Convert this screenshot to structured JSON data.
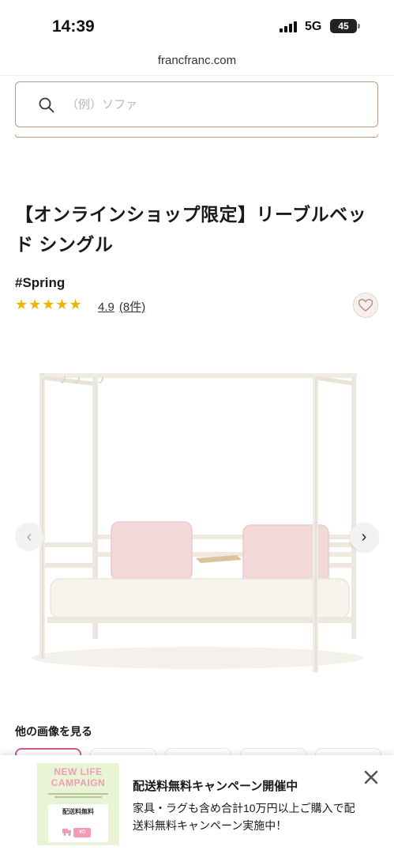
{
  "status_bar": {
    "time": "14:39",
    "network": "5G",
    "battery": "45"
  },
  "browser": {
    "url": "francfranc.com"
  },
  "search": {
    "placeholder": "（例）ソファ",
    "value": "",
    "icon": "search-icon"
  },
  "product": {
    "title": "【オンラインショップ限定】リーブルベッド シングル",
    "tag": "#Spring",
    "stars": "★★★★★",
    "rating_value": "4.9",
    "rating_count": "(8件)",
    "favorite_icon": "heart-icon"
  },
  "gallery": {
    "prev_icon": "chevron-left-icon",
    "next_icon": "chevron-right-icon",
    "prev_label": "‹",
    "next_label": "›",
    "more_images_label": "他の画像を見る"
  },
  "campaign": {
    "thumb_title": "NEW LIFE CAMPAIGN",
    "thumb_card_label": "配送料無料",
    "thumb_card_price": "¥0",
    "heading": "配送料無料キャンペーン開催中",
    "body": "家具・ラグも含め合計10万円以上ご購入で配送料無料キャンペーン実施中！",
    "close_icon": "close-icon"
  },
  "colors": {
    "accent_border": "#b99a86",
    "star": "#f0b400",
    "campaign_pink": "#f29bb7",
    "campaign_green": "#e9f4d4",
    "thumb_active": "#d15a8f"
  }
}
